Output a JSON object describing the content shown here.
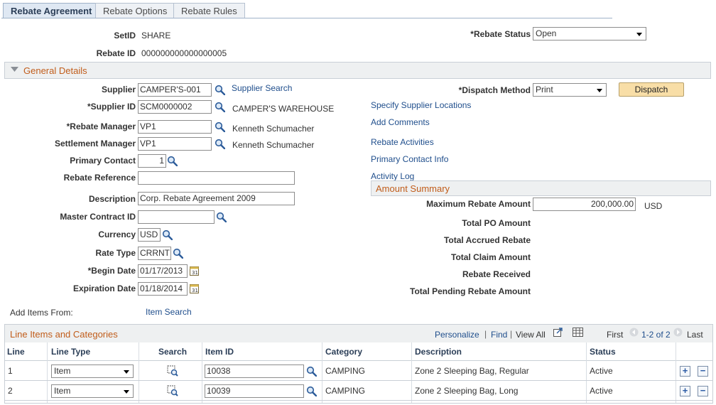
{
  "tabs": [
    "Rebate Agreement",
    "Rebate Options",
    "Rebate Rules"
  ],
  "header": {
    "setid_label": "SetID",
    "setid_value": "SHARE",
    "rebate_id_label": "Rebate ID",
    "rebate_id_value": "000000000000000005",
    "rebate_status_label": "*Rebate Status",
    "rebate_status_value": "Open"
  },
  "general": {
    "title": "General Details",
    "supplier_label": "Supplier",
    "supplier_value": "CAMPER'S-001",
    "supplier_search": "Supplier Search",
    "supplier_id_label": "*Supplier ID",
    "supplier_id_value": "SCM0000002",
    "supplier_name": "CAMPER'S WAREHOUSE",
    "rebate_manager_label": "*Rebate Manager",
    "rebate_manager_value": "VP1",
    "rebate_manager_name": "Kenneth Schumacher",
    "settlement_manager_label": "Settlement Manager",
    "settlement_manager_value": "VP1",
    "settlement_manager_name": "Kenneth Schumacher",
    "primary_contact_label": "Primary Contact",
    "primary_contact_value": "1",
    "rebate_reference_label": "Rebate Reference",
    "rebate_reference_value": "",
    "description_label": "Description",
    "description_value": "Corp. Rebate Agreement 2009",
    "master_contract_label": "Master Contract ID",
    "master_contract_value": "",
    "currency_label": "Currency",
    "currency_value": "USD",
    "rate_type_label": "Rate Type",
    "rate_type_value": "CRRNT",
    "begin_date_label": "*Begin Date",
    "begin_date_value": "01/17/2013",
    "expiration_date_label": "Expiration Date",
    "expiration_date_value": "01/18/2014",
    "dispatch_method_label": "*Dispatch Method",
    "dispatch_method_value": "Print",
    "dispatch_button": "Dispatch",
    "links": [
      "Specify Supplier Locations",
      "Add Comments",
      "Rebate Activities",
      "Primary Contact Info",
      "Activity Log"
    ],
    "add_items_label": "Add Items From:",
    "item_search": "Item Search"
  },
  "amount_summary": {
    "title": "Amount Summary",
    "max_rebate_label": "Maximum Rebate Amount",
    "max_rebate_value": "200,000.00",
    "currency": "USD",
    "rows": [
      "Total PO Amount",
      "Total Accrued Rebate",
      "Total Claim Amount",
      "Rebate Received",
      "Total Pending Rebate Amount"
    ]
  },
  "line_items": {
    "title": "Line Items and Categories",
    "personalize": "Personalize",
    "find": "Find",
    "view_all": "View All",
    "first": "First",
    "range": "1-2 of 2",
    "last": "Last",
    "columns": [
      "Line",
      "Line Type",
      "Search",
      "Item ID",
      "Category",
      "Description",
      "Status"
    ],
    "rows": [
      {
        "line": "1",
        "line_type": "Item",
        "item_id": "10038",
        "category": "CAMPING",
        "description": "Zone 2 Sleeping Bag, Regular",
        "status": "Active"
      },
      {
        "line": "2",
        "line_type": "Item",
        "item_id": "10039",
        "category": "CAMPING",
        "description": "Zone 2 Sleeping Bag, Long",
        "status": "Active"
      }
    ]
  },
  "colors": {
    "link": "#1f4e8c",
    "section_title": "#c15d1b",
    "dispatch_button": "#f8dea7"
  }
}
